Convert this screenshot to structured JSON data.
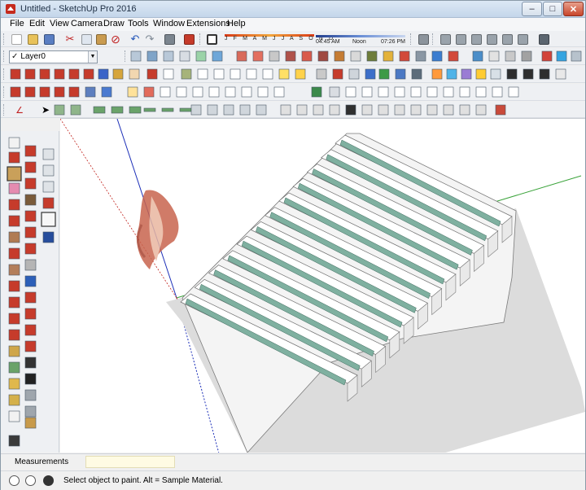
{
  "window": {
    "title": "Untitled - SketchUp Pro 2016",
    "minimize": "–",
    "maximize": "□",
    "close": "✕"
  },
  "menu": [
    "File",
    "Edit",
    "View",
    "Camera",
    "Draw",
    "Tools",
    "Window",
    "Extensions",
    "Help"
  ],
  "layer": {
    "name": "Layer0",
    "check": "✓"
  },
  "shadow": {
    "months": "J F M A M J J A S O N D",
    "time_start": "04:45 AM",
    "time_noon": "Noon",
    "time_end": "07:26 PM"
  },
  "measurements": {
    "label": "Measurements",
    "value": ""
  },
  "status": {
    "text": "Select object to paint. Alt = Sample Material."
  },
  "icons": {
    "row1": [
      "new-icon",
      "open-icon",
      "save-icon",
      "cut-icon",
      "copy-icon",
      "paste-icon",
      "erase-icon",
      "undo-icon",
      "redo-icon",
      "print-icon",
      "model-info-icon",
      "shadows-icon"
    ],
    "row1_right": [
      "iso-view-icon",
      "top-view-icon",
      "front-view-icon",
      "right-view-icon",
      "back-view-icon",
      "left-view-icon",
      "bottom-view-icon"
    ],
    "left_tools": [
      "select-icon",
      "component-icon",
      "paint-bucket-icon",
      "eraser-icon",
      "line-icon",
      "freehand-icon",
      "rectangle-icon",
      "rotated-rect-icon",
      "circle-icon",
      "polygon-icon",
      "arc-icon",
      "pie-icon",
      "move-icon",
      "push-pull-icon",
      "rotate-icon",
      "follow-me-icon",
      "scale-icon",
      "offset-icon",
      "tape-measure-icon",
      "dimension-icon",
      "protractor-icon",
      "text-icon",
      "axes-icon",
      "3d-text-icon",
      "orbit-icon",
      "pan-icon",
      "zoom-icon",
      "zoom-window-icon",
      "walk-icon",
      "section-plane-icon"
    ]
  },
  "colors": {
    "accent_red": "#c62d1f",
    "accent_blue": "#2f5fbf",
    "glass": "#7fb0a0",
    "axis_green": "#3aa33a",
    "axis_blue": "#1c2fb8",
    "axis_red": "#c0201a"
  }
}
